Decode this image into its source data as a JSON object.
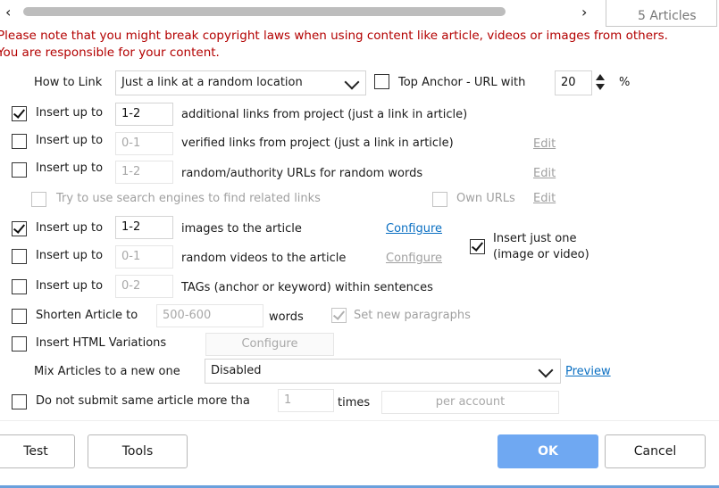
{
  "top": {
    "articles_count": "5 Articles",
    "warning_line1": "Please note that you might break copyright laws when using content like article, videos or images from others.",
    "warning_line2": "You are responsible for your content."
  },
  "link": {
    "how_to_link_label": "How to Link",
    "how_to_link_value": "Just a link at a random location",
    "top_anchor_label": "Top Anchor - URL with",
    "top_anchor_value": "20",
    "top_anchor_unit": "%"
  },
  "rows": [
    {
      "checked": true,
      "label": "Insert up to",
      "value": "1-2",
      "desc": "additional links from project (just a link in article)"
    },
    {
      "checked": false,
      "label": "Insert up to",
      "value": "0-1",
      "desc": "verified links from project (just a link in article)",
      "action": "Edit"
    },
    {
      "checked": false,
      "label": "Insert up to",
      "value": "1-2",
      "desc": "random/authority URLs for random words",
      "action": "Edit"
    },
    {
      "checked": false,
      "label": "Try to use search engines to find related links",
      "own_urls": "Own URLs",
      "action": "Edit"
    },
    {
      "checked": true,
      "label": "Insert up to",
      "value": "1-2",
      "desc": "images to the article",
      "action": "Configure"
    },
    {
      "checked": false,
      "label": "Insert up to",
      "value": "0-1",
      "desc": "random videos to the article",
      "action": "Configure"
    },
    {
      "checked": false,
      "label": "Insert up to",
      "value": "0-2",
      "desc": "TAGs (anchor or keyword) within sentences"
    }
  ],
  "insert_just_one": {
    "checked": true,
    "line1": "Insert just one",
    "line2": "(image or video)"
  },
  "shorten": {
    "label": "Shorten Article to",
    "value": "500-600",
    "unit": "words",
    "paragraphs_checked": true,
    "paragraphs_label": "Set new paragraphs"
  },
  "html_variations": {
    "label": "Insert HTML Variations",
    "button": "Configure"
  },
  "mix": {
    "label": "Mix Articles to a new one",
    "value": "Disabled",
    "preview": "Preview"
  },
  "no_submit": {
    "label": "Do not submit same article more tha",
    "value": "1",
    "unit": "times",
    "per": "per account"
  },
  "buttons": {
    "test": "Test",
    "tools": "Tools",
    "ok": "OK",
    "cancel": "Cancel"
  },
  "colors": {
    "warning": "#b30000",
    "link": "#0a6fc2",
    "ok_button": "#6fa8f2"
  }
}
